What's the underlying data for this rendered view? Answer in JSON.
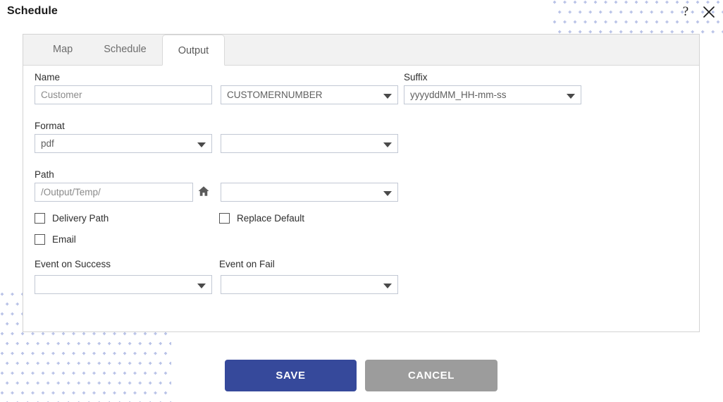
{
  "header": {
    "title": "Schedule",
    "help_icon": "question-mark-icon",
    "close_icon": "close-icon"
  },
  "tabs": [
    {
      "label": "Map",
      "active": false
    },
    {
      "label": "Schedule",
      "active": false
    },
    {
      "label": "Output",
      "active": true
    }
  ],
  "form": {
    "name": {
      "label": "Name",
      "value": "Customer",
      "placeholder": "Customer",
      "token_select_value": "CUSTOMERNUMBER"
    },
    "suffix": {
      "label": "Suffix",
      "value": "yyyyddMM_HH-mm-ss"
    },
    "format": {
      "label": "Format",
      "value": "pdf",
      "second_select_value": ""
    },
    "path": {
      "label": "Path",
      "value": "/Output/Temp/",
      "placeholder": "/Output/Temp/",
      "home_icon": "home-icon",
      "second_select_value": ""
    },
    "checkboxes": [
      {
        "label": "Delivery Path",
        "checked": false
      },
      {
        "label": "Replace Default",
        "checked": false
      },
      {
        "label": "Email",
        "checked": false
      }
    ],
    "event_on_success": {
      "label": "Event on Success",
      "value": ""
    },
    "event_on_fail": {
      "label": "Event on Fail",
      "value": ""
    }
  },
  "footer": {
    "save_label": "SAVE",
    "cancel_label": "CANCEL"
  },
  "colors": {
    "save_button": "#36499b",
    "cancel_button": "#9c9c9c",
    "tab_bar": "#f2f2f2",
    "dot_pattern": "#b6c0e6"
  }
}
